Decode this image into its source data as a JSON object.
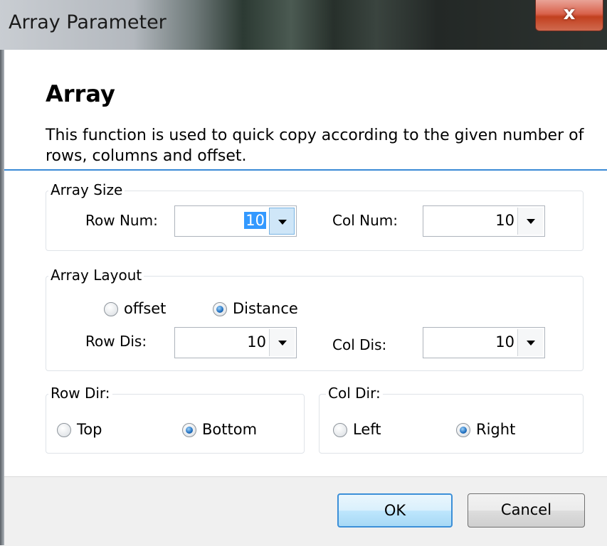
{
  "window": {
    "title": "Array Parameter",
    "close_glyph": "x"
  },
  "header": {
    "heading": "Array",
    "description": "This function is used to quick copy according to the given number of rows, columns and offset."
  },
  "array_size": {
    "legend": "Array Size",
    "row_num_label": "Row Num:",
    "row_num_value": "10",
    "col_num_label": "Col Num:",
    "col_num_value": "10"
  },
  "array_layout": {
    "legend": "Array Layout",
    "mode_options": [
      {
        "label": "offset",
        "selected": false
      },
      {
        "label": "Distance",
        "selected": true
      }
    ],
    "row_dis_label": "Row Dis:",
    "row_dis_value": "10",
    "col_dis_label": "Col Dis:",
    "col_dis_value": "10"
  },
  "row_dir": {
    "legend": "Row Dir:",
    "options": [
      {
        "label": "Top",
        "selected": false
      },
      {
        "label": "Bottom",
        "selected": true
      }
    ]
  },
  "col_dir": {
    "legend": "Col Dir:",
    "options": [
      {
        "label": "Left",
        "selected": false
      },
      {
        "label": "Right",
        "selected": true
      }
    ]
  },
  "buttons": {
    "ok": "OK",
    "cancel": "Cancel"
  },
  "colors": {
    "accent": "#3a8ad6",
    "selection": "#3399ff",
    "close_red": "#c2401f"
  },
  "icons": {
    "close": "close-icon",
    "dropdown": "chevron-down-icon",
    "radio": "radio-button-icon"
  }
}
